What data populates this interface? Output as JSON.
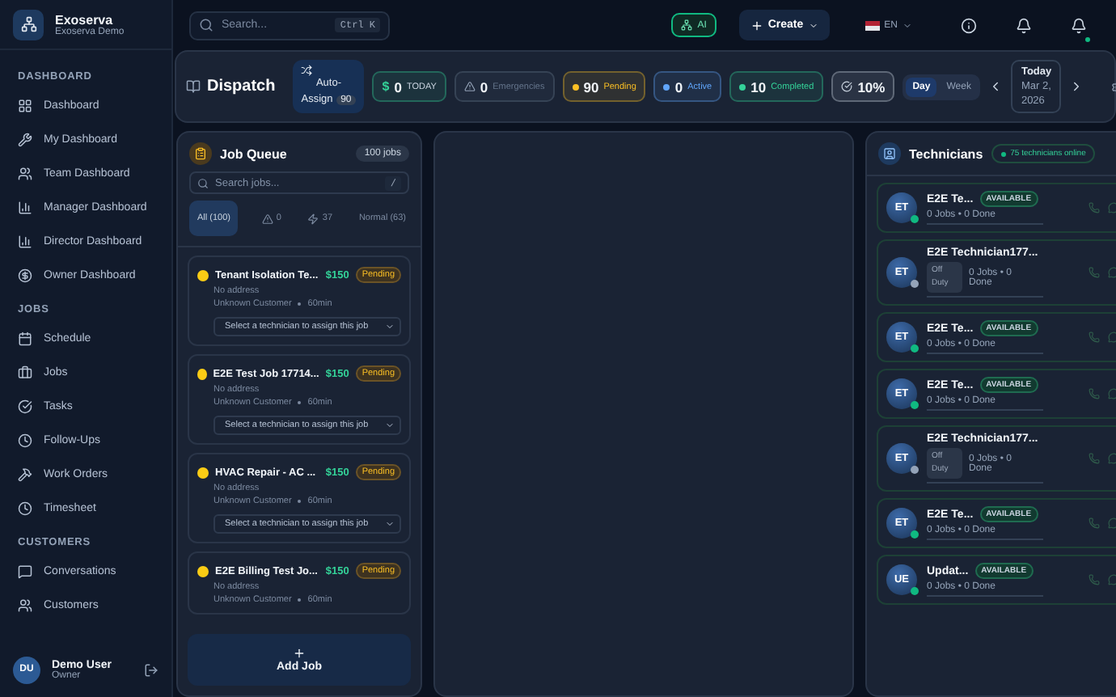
{
  "brand": {
    "name": "Exoserva",
    "subtitle": "Exoserva Demo"
  },
  "sidebar": {
    "sections": [
      {
        "title": "DASHBOARD",
        "items": [
          {
            "label": "Dashboard",
            "selected": false
          },
          {
            "label": "My Dashboard",
            "selected": false
          },
          {
            "label": "Team Dashboard",
            "selected": false
          },
          {
            "label": "Manager Dashboard",
            "selected": false
          },
          {
            "label": "Director Dashboard",
            "selected": false
          },
          {
            "label": "Owner Dashboard",
            "selected": false
          }
        ]
      },
      {
        "title": "JOBS",
        "items": [
          {
            "label": "Schedule",
            "selected": false
          },
          {
            "label": "Jobs",
            "selected": false
          },
          {
            "label": "Tasks",
            "selected": false
          },
          {
            "label": "Follow-Ups",
            "selected": false
          },
          {
            "label": "Work Orders",
            "selected": false
          },
          {
            "label": "Timesheet",
            "selected": false
          }
        ]
      },
      {
        "title": "CUSTOMERS",
        "items": [
          {
            "label": "Conversations",
            "selected": false
          },
          {
            "label": "Customers",
            "selected": false
          }
        ]
      }
    ]
  },
  "user": {
    "initials": "DU",
    "name": "Demo User",
    "role": "Owner"
  },
  "topbar": {
    "search": {
      "placeholder": "Search...",
      "shortcut": "Ctrl K"
    },
    "ai_label": "AI",
    "create_label": "Create",
    "language": "EN",
    "notifications_unread": true
  },
  "dispatch": {
    "title": "Dispatch",
    "auto_assign": {
      "label": "Auto-Assign",
      "count": "90"
    },
    "stats": [
      {
        "kind": "money",
        "prefix": "$",
        "value": "0",
        "label": "TODAY",
        "color": "#34d399"
      },
      {
        "kind": "alert",
        "value": "0",
        "label": "Emergencies",
        "color": "#64748b"
      },
      {
        "kind": "dot",
        "value": "90",
        "label": "Pending",
        "color": "#fbbf24"
      },
      {
        "kind": "dot",
        "value": "0",
        "label": "Active",
        "color": "#60a5fa"
      },
      {
        "kind": "dot",
        "value": "10",
        "label": "Completed",
        "color": "#34d399"
      },
      {
        "kind": "check",
        "value": "10%",
        "color": "#cbd5e1"
      }
    ],
    "views": [
      {
        "label": "Day",
        "selected": true
      },
      {
        "label": "Week",
        "selected": false
      }
    ],
    "date": {
      "label": "Today",
      "value": "Mar 2, 2026"
    }
  },
  "job_queue": {
    "title": "Job Queue",
    "count": "100 jobs",
    "search_placeholder": "Search jobs...",
    "search_key": "/",
    "filters": [
      {
        "kind": "text",
        "label": "All (100)",
        "selected": true
      },
      {
        "kind": "alert",
        "label": "0",
        "selected": false
      },
      {
        "kind": "bolt",
        "label": "37",
        "selected": false
      },
      {
        "kind": "text",
        "label": "Normal (63)",
        "selected": false
      }
    ],
    "jobs": [
      {
        "title": "Tenant Isolation Te...",
        "price": "$150",
        "status": "Pending",
        "address": "No address",
        "customer": "Unknown Customer",
        "duration": "60min",
        "assign_placeholder": "Select a technician to assign this job"
      },
      {
        "title": "E2E Test Job 17714...",
        "price": "$150",
        "status": "Pending",
        "address": "No address",
        "customer": "Unknown Customer",
        "duration": "60min",
        "assign_placeholder": "Select a technician to assign this job"
      },
      {
        "title": "HVAC Repair - AC ...",
        "price": "$150",
        "status": "Pending",
        "address": "No address",
        "customer": "Unknown Customer",
        "duration": "60min",
        "assign_placeholder": "Select a technician to assign this job"
      },
      {
        "title": "E2E Billing Test Jo...",
        "price": "$150",
        "status": "Pending",
        "address": "No address",
        "customer": "Unknown Customer",
        "duration": "60min"
      }
    ],
    "add_label": "Add Job"
  },
  "technicians": {
    "title": "Technicians",
    "online": "75 technicians online",
    "items": [
      {
        "initials": "ET",
        "name": "E2E Te...",
        "kind": "available",
        "status_label": "AVAILABLE",
        "stats": "0 Jobs • 0 Done"
      },
      {
        "initials": "ET",
        "name": "E2E Technician177...",
        "kind": "off",
        "status_label": "Off Duty",
        "stats": "0 Jobs • 0 Done"
      },
      {
        "initials": "ET",
        "name": "E2E Te...",
        "kind": "available",
        "status_label": "AVAILABLE",
        "stats": "0 Jobs • 0 Done"
      },
      {
        "initials": "ET",
        "name": "E2E Te...",
        "kind": "available",
        "status_label": "AVAILABLE",
        "stats": "0 Jobs • 0 Done"
      },
      {
        "initials": "ET",
        "name": "E2E Technician177...",
        "kind": "off",
        "status_label": "Off Duty",
        "stats": "0 Jobs • 0 Done"
      },
      {
        "initials": "ET",
        "name": "E2E Te...",
        "kind": "available",
        "status_label": "AVAILABLE",
        "stats": "0 Jobs • 0 Done"
      },
      {
        "initials": "UE",
        "name": "Updat...",
        "kind": "available",
        "status_label": "AVAILABLE",
        "stats": "0 Jobs • 0 Done"
      }
    ]
  }
}
